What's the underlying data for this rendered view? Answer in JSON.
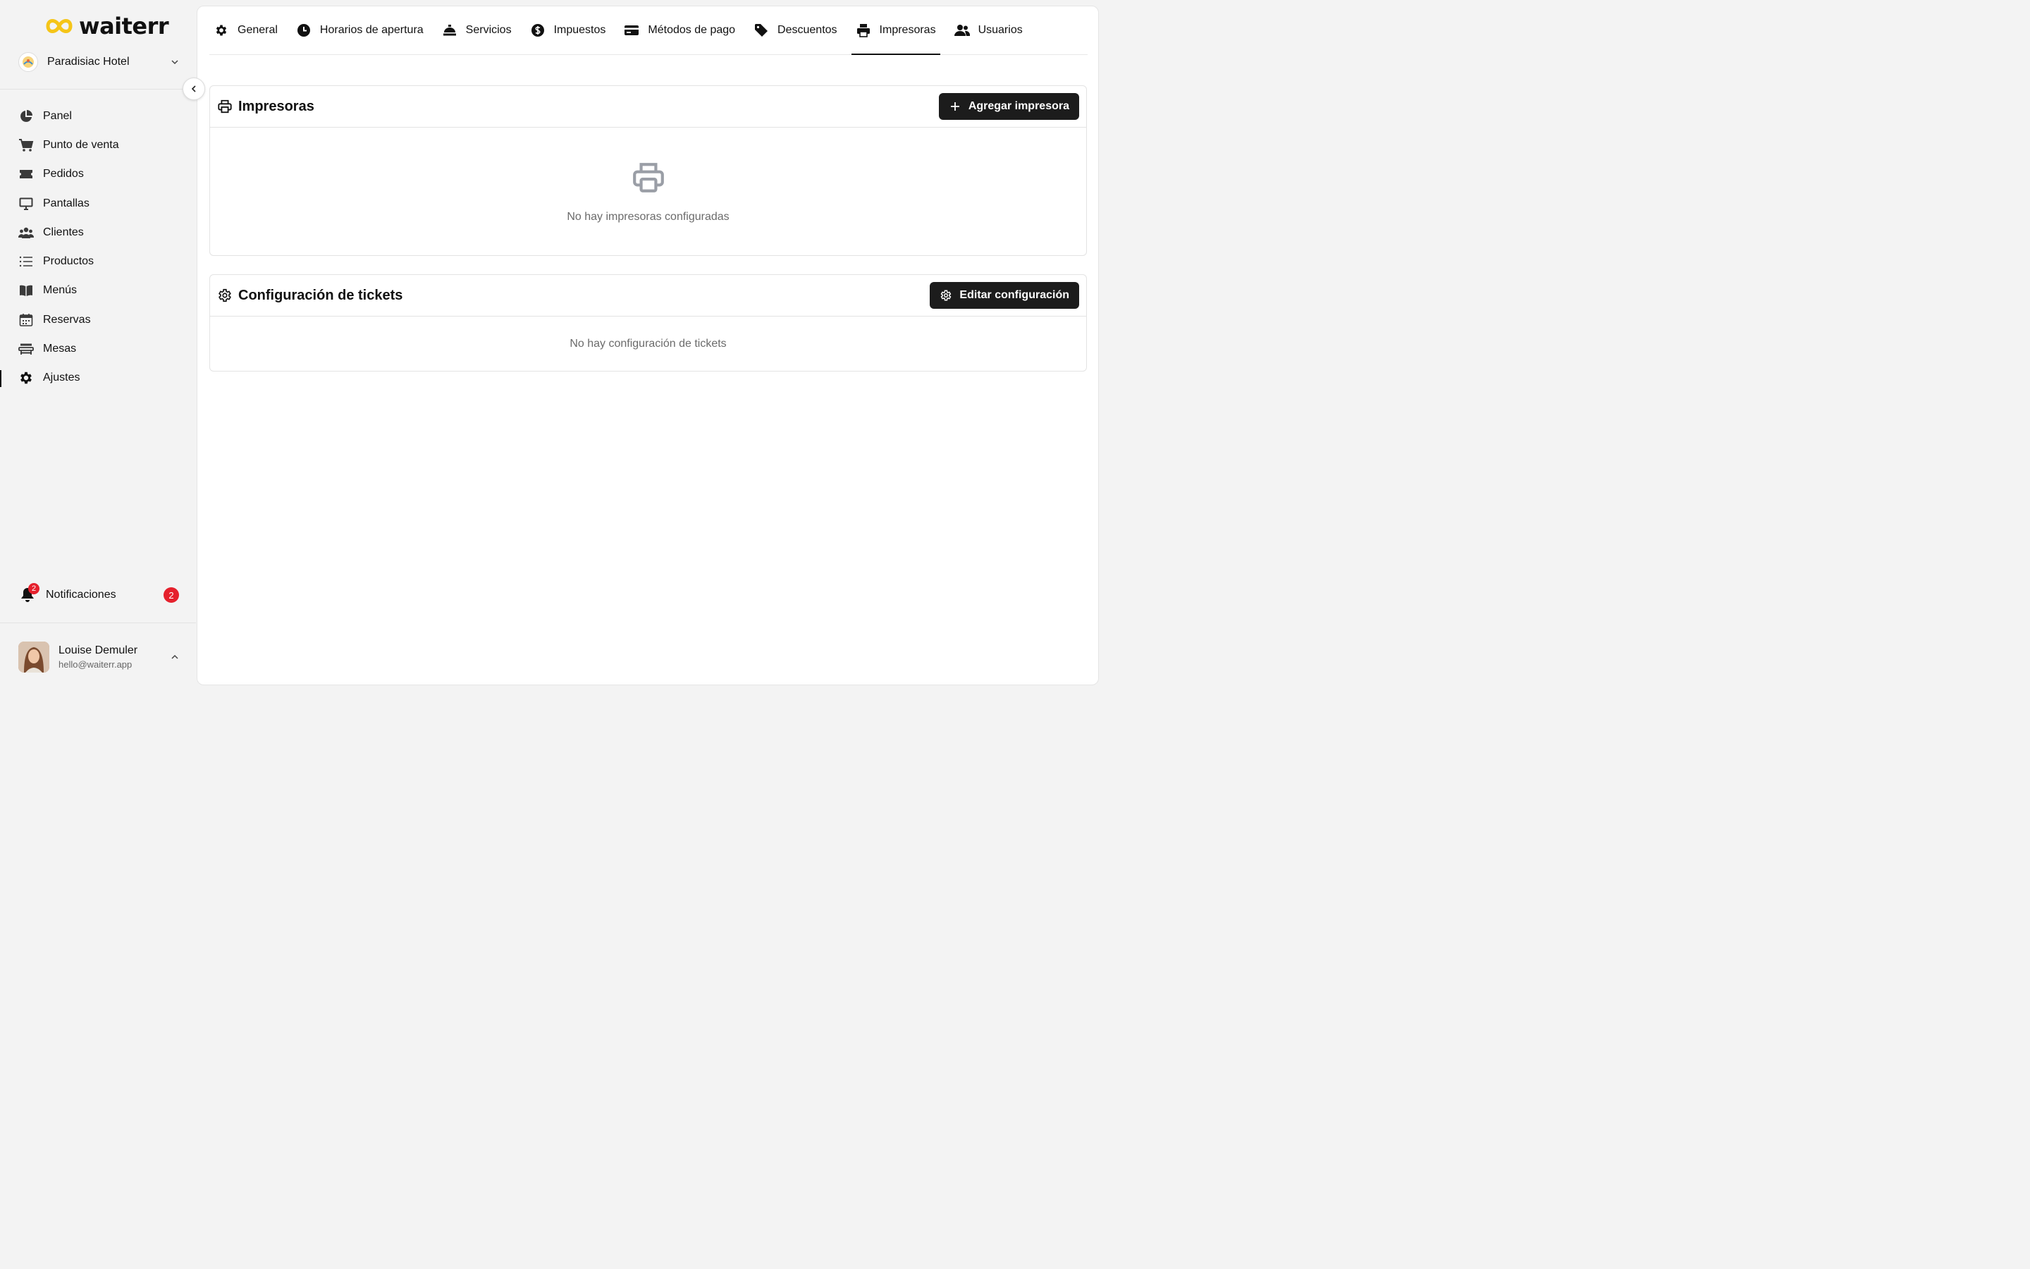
{
  "brand": {
    "name": "waiterr"
  },
  "hotel": {
    "name": "Paradisiac Hotel"
  },
  "sidebar": {
    "items": [
      {
        "label": "Panel",
        "icon": "pie-chart-icon"
      },
      {
        "label": "Punto de venta",
        "icon": "cart-icon"
      },
      {
        "label": "Pedidos",
        "icon": "ticket-icon"
      },
      {
        "label": "Pantallas",
        "icon": "monitor-icon"
      },
      {
        "label": "Clientes",
        "icon": "users-icon"
      },
      {
        "label": "Productos",
        "icon": "list-icon"
      },
      {
        "label": "Menús",
        "icon": "book-icon"
      },
      {
        "label": "Reservas",
        "icon": "calendar-icon"
      },
      {
        "label": "Mesas",
        "icon": "table-icon"
      },
      {
        "label": "Ajustes",
        "icon": "gear-icon",
        "active": true
      }
    ]
  },
  "notifications": {
    "label": "Notificaciones",
    "count": "2",
    "badge": "2"
  },
  "user": {
    "name": "Louise Demuler",
    "email": "hello@waiterr.app"
  },
  "tabs": [
    {
      "label": "General",
      "icon": "gear-icon"
    },
    {
      "label": "Horarios de apertura",
      "icon": "clock-icon"
    },
    {
      "label": "Servicios",
      "icon": "cloche-icon"
    },
    {
      "label": "Impuestos",
      "icon": "dollar-icon"
    },
    {
      "label": "Métodos de pago",
      "icon": "credit-card-icon"
    },
    {
      "label": "Descuentos",
      "icon": "tag-icon"
    },
    {
      "label": "Impresoras",
      "icon": "printer-icon",
      "active": true
    },
    {
      "label": "Usuarios",
      "icon": "user-group-icon"
    }
  ],
  "printers": {
    "title": "Impresoras",
    "add_button": "Agregar impresora",
    "empty": "No hay impresoras configuradas"
  },
  "tickets": {
    "title": "Configuración de tickets",
    "edit_button": "Editar configuración",
    "empty": "No hay configuración de tickets"
  },
  "colors": {
    "accent": "#1c1c1c",
    "badge": "#e5202c",
    "logo_yellow": "#f5c518"
  }
}
